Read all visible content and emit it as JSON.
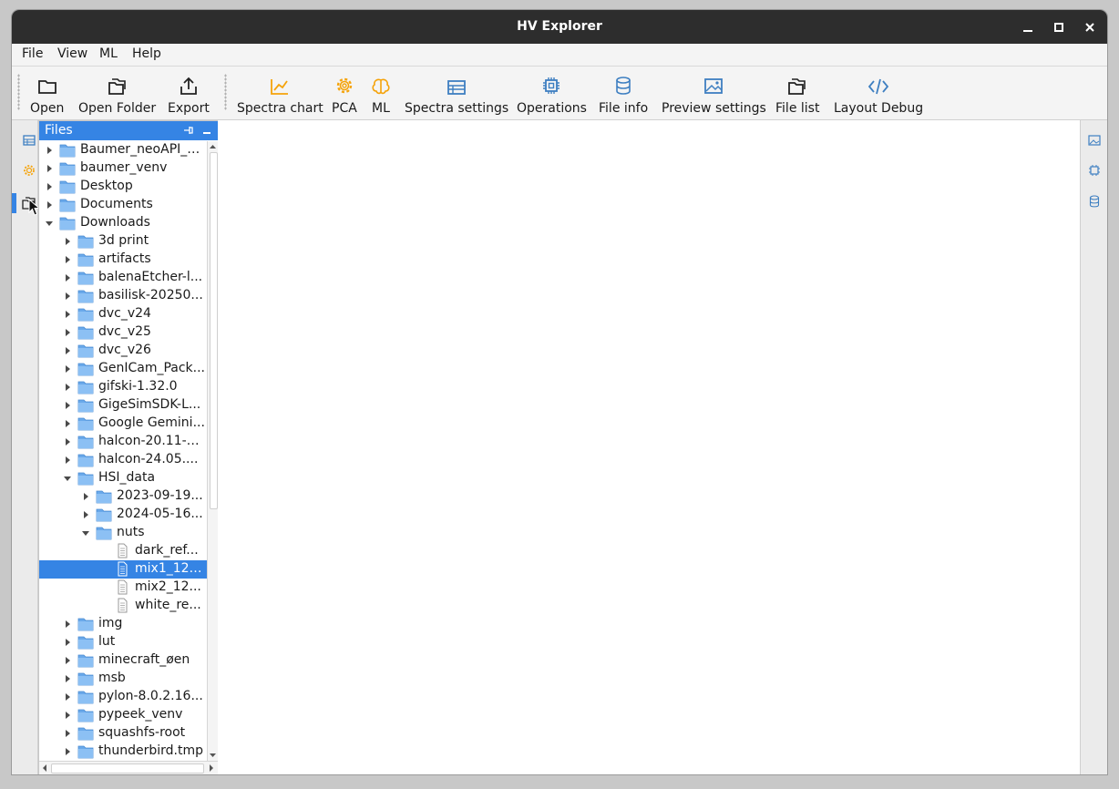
{
  "window": {
    "title": "HV Explorer"
  },
  "menu": [
    "File",
    "View",
    "ML",
    "Help"
  ],
  "toolbar": [
    {
      "label": "Open",
      "icon": "folder-icon"
    },
    {
      "label": "Open Folder",
      "icon": "folder-open-icon"
    },
    {
      "label": "Export",
      "icon": "export-icon"
    },
    {
      "label": "Spectra chart",
      "icon": "chart-icon"
    },
    {
      "label": "PCA",
      "icon": "gear-icon"
    },
    {
      "label": "ML",
      "icon": "brain-icon"
    },
    {
      "label": "Spectra settings",
      "icon": "table-settings-icon"
    },
    {
      "label": "Operations",
      "icon": "chip-icon"
    },
    {
      "label": "File info",
      "icon": "database-icon"
    },
    {
      "label": "Preview settings",
      "icon": "image-icon"
    },
    {
      "label": "File list",
      "icon": "folders-icon"
    },
    {
      "label": "Layout Debug",
      "icon": "code-icon"
    }
  ],
  "dock": {
    "title": "Files"
  },
  "tree": [
    {
      "name": "Baumer_neoAPI_1...",
      "type": "folder",
      "level": 0,
      "state": "collapsed"
    },
    {
      "name": "baumer_venv",
      "type": "folder",
      "level": 0,
      "state": "collapsed"
    },
    {
      "name": "Desktop",
      "type": "folder",
      "level": 0,
      "state": "collapsed"
    },
    {
      "name": "Documents",
      "type": "folder",
      "level": 0,
      "state": "collapsed"
    },
    {
      "name": "Downloads",
      "type": "folder",
      "level": 0,
      "state": "expanded"
    },
    {
      "name": "3d print",
      "type": "folder",
      "level": 1,
      "state": "collapsed"
    },
    {
      "name": "artifacts",
      "type": "folder",
      "level": 1,
      "state": "collapsed"
    },
    {
      "name": "balenaEtcher-l...",
      "type": "folder",
      "level": 1,
      "state": "collapsed"
    },
    {
      "name": "basilisk-20250...",
      "type": "folder",
      "level": 1,
      "state": "collapsed"
    },
    {
      "name": "dvc_v24",
      "type": "folder",
      "level": 1,
      "state": "collapsed"
    },
    {
      "name": "dvc_v25",
      "type": "folder",
      "level": 1,
      "state": "collapsed"
    },
    {
      "name": "dvc_v26",
      "type": "folder",
      "level": 1,
      "state": "collapsed"
    },
    {
      "name": "GenICam_Pack...",
      "type": "folder",
      "level": 1,
      "state": "collapsed"
    },
    {
      "name": "gifski-1.32.0",
      "type": "folder",
      "level": 1,
      "state": "collapsed"
    },
    {
      "name": "GigeSimSDK-L...",
      "type": "folder",
      "level": 1,
      "state": "collapsed"
    },
    {
      "name": "Google Gemini...",
      "type": "folder",
      "level": 1,
      "state": "collapsed"
    },
    {
      "name": "halcon-20.11-x...",
      "type": "folder",
      "level": 1,
      "state": "collapsed"
    },
    {
      "name": "halcon-24.05....",
      "type": "folder",
      "level": 1,
      "state": "collapsed"
    },
    {
      "name": "HSI_data",
      "type": "folder",
      "level": 1,
      "state": "expanded"
    },
    {
      "name": "2023-09-19...",
      "type": "folder",
      "level": 2,
      "state": "collapsed"
    },
    {
      "name": "2024-05-16...",
      "type": "folder",
      "level": 2,
      "state": "collapsed"
    },
    {
      "name": "nuts",
      "type": "folder",
      "level": 2,
      "state": "expanded"
    },
    {
      "name": "dark_ref...",
      "type": "file",
      "level": 3,
      "state": "none"
    },
    {
      "name": "mix1_129...",
      "type": "file",
      "level": 3,
      "state": "none",
      "selected": true
    },
    {
      "name": "mix2_12...",
      "type": "file",
      "level": 3,
      "state": "none"
    },
    {
      "name": "white_re...",
      "type": "file",
      "level": 3,
      "state": "none"
    },
    {
      "name": "img",
      "type": "folder",
      "level": 1,
      "state": "collapsed"
    },
    {
      "name": "lut",
      "type": "folder",
      "level": 1,
      "state": "collapsed"
    },
    {
      "name": "minecraft_øen",
      "type": "folder",
      "level": 1,
      "state": "collapsed"
    },
    {
      "name": "msb",
      "type": "folder",
      "level": 1,
      "state": "collapsed"
    },
    {
      "name": "pylon-8.0.2.16...",
      "type": "folder",
      "level": 1,
      "state": "collapsed"
    },
    {
      "name": "pypeek_venv",
      "type": "folder",
      "level": 1,
      "state": "collapsed"
    },
    {
      "name": "squashfs-root",
      "type": "folder",
      "level": 1,
      "state": "collapsed"
    },
    {
      "name": "thunderbird.tmp",
      "type": "folder",
      "level": 1,
      "state": "collapsed"
    }
  ],
  "colors": {
    "accent": "#3584e4",
    "orange": "#f5a30a",
    "blue": "#3e7fc1",
    "folder": "#6aa9ea"
  }
}
